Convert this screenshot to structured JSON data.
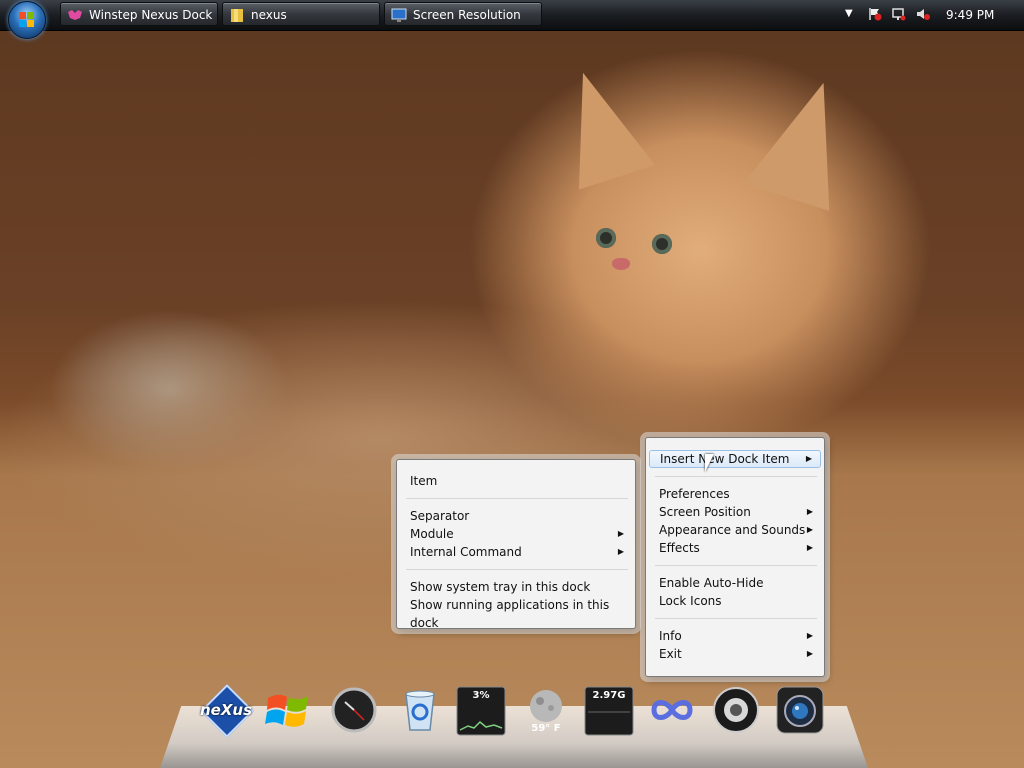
{
  "taskbar": {
    "buttons": [
      {
        "label": "Winstep Nexus Dock ...",
        "icon": "winstep-icon"
      },
      {
        "label": "nexus",
        "icon": "folder-icon"
      },
      {
        "label": "Screen Resolution",
        "icon": "monitor-icon"
      }
    ],
    "clock": "9:49 PM",
    "tray_icons": [
      "show-hidden-icons-arrow",
      "action-center-flag-icon",
      "network-icon",
      "volume-muted-icon"
    ]
  },
  "menu_left": {
    "items": [
      {
        "label": "Item"
      },
      {
        "label": "Separator"
      },
      {
        "label": "Module",
        "submenu": true
      },
      {
        "label": "Internal Command",
        "submenu": true
      },
      {
        "label": "Show system tray in this dock"
      },
      {
        "label": "Show running applications in this dock"
      }
    ]
  },
  "menu_right": {
    "items": [
      {
        "label": "Insert New Dock Item",
        "submenu": true,
        "highlighted": true
      },
      {
        "label": "Preferences"
      },
      {
        "label": "Screen Position",
        "submenu": true
      },
      {
        "label": "Appearance and Sounds",
        "submenu": true
      },
      {
        "label": "Effects",
        "submenu": true
      },
      {
        "label": "Enable Auto-Hide"
      },
      {
        "label": "Lock Icons"
      },
      {
        "label": "Info",
        "submenu": true
      },
      {
        "label": "Exit",
        "submenu": true
      }
    ]
  },
  "dock": {
    "items": [
      {
        "name": "nexus-logo-icon",
        "label": "neXus"
      },
      {
        "name": "windows-logo-icon"
      },
      {
        "name": "clock-icon"
      },
      {
        "name": "recycle-bin-icon"
      },
      {
        "name": "cpu-meter-icon",
        "label": "3%"
      },
      {
        "name": "weather-icon",
        "label": "59° F"
      },
      {
        "name": "memory-meter-icon",
        "label": "2.97G"
      },
      {
        "name": "infinity-icon"
      },
      {
        "name": "speaker-icon"
      },
      {
        "name": "camera-icon"
      }
    ]
  }
}
